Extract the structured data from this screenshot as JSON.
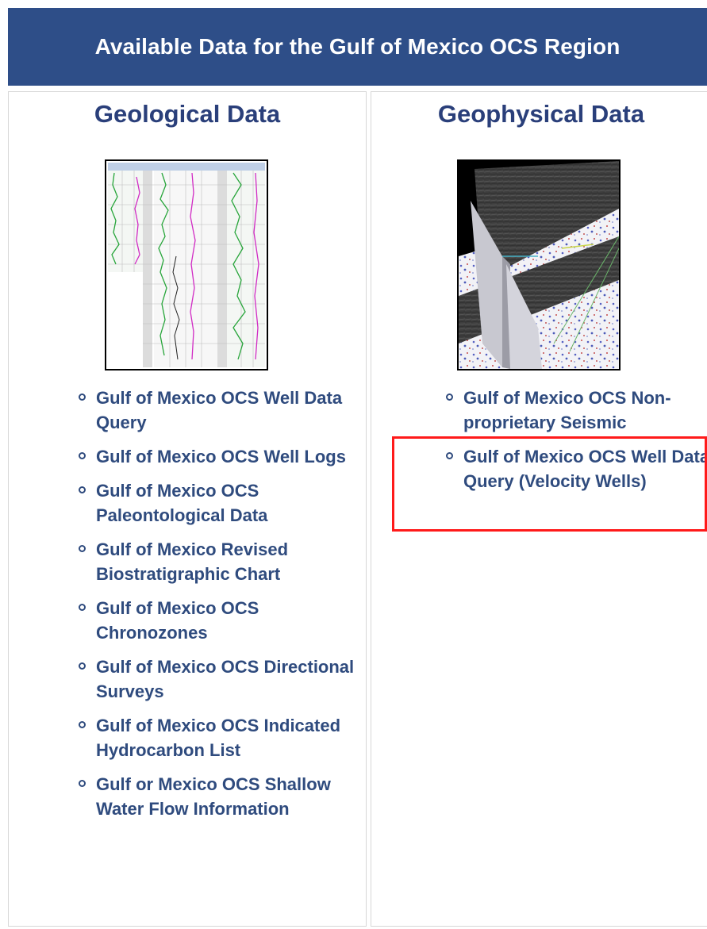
{
  "header": {
    "title": "Available Data for the Gulf of Mexico OCS Region"
  },
  "geological": {
    "title": "Geological Data",
    "image": "well-log-thumbnail",
    "links": [
      {
        "label": "Gulf of Mexico OCS Well Data Query"
      },
      {
        "label": "Gulf of Mexico OCS Well Logs"
      },
      {
        "label": "Gulf of Mexico OCS Paleontological Data"
      },
      {
        "label": "Gulf of Mexico Revised Biostratigraphic Chart"
      },
      {
        "label": "Gulf of Mexico OCS Chronozones"
      },
      {
        "label": "Gulf of Mexico OCS Directional Surveys"
      },
      {
        "label": "Gulf of Mexico OCS Indicated Hydrocarbon List"
      },
      {
        "label": "Gulf or Mexico OCS Shallow Water Flow Information"
      }
    ]
  },
  "geophysical": {
    "title": "Geophysical Data",
    "image": "seismic-thumbnail",
    "links": [
      {
        "label": "Gulf of Mexico OCS Non-proprietary Seismic"
      },
      {
        "label": "Gulf of Mexico OCS Well Data Query (Velocity Wells)"
      }
    ]
  },
  "colors": {
    "header_bg": "#2e4e88",
    "link": "#2f4b7e",
    "highlight": "#ff1a1a"
  }
}
